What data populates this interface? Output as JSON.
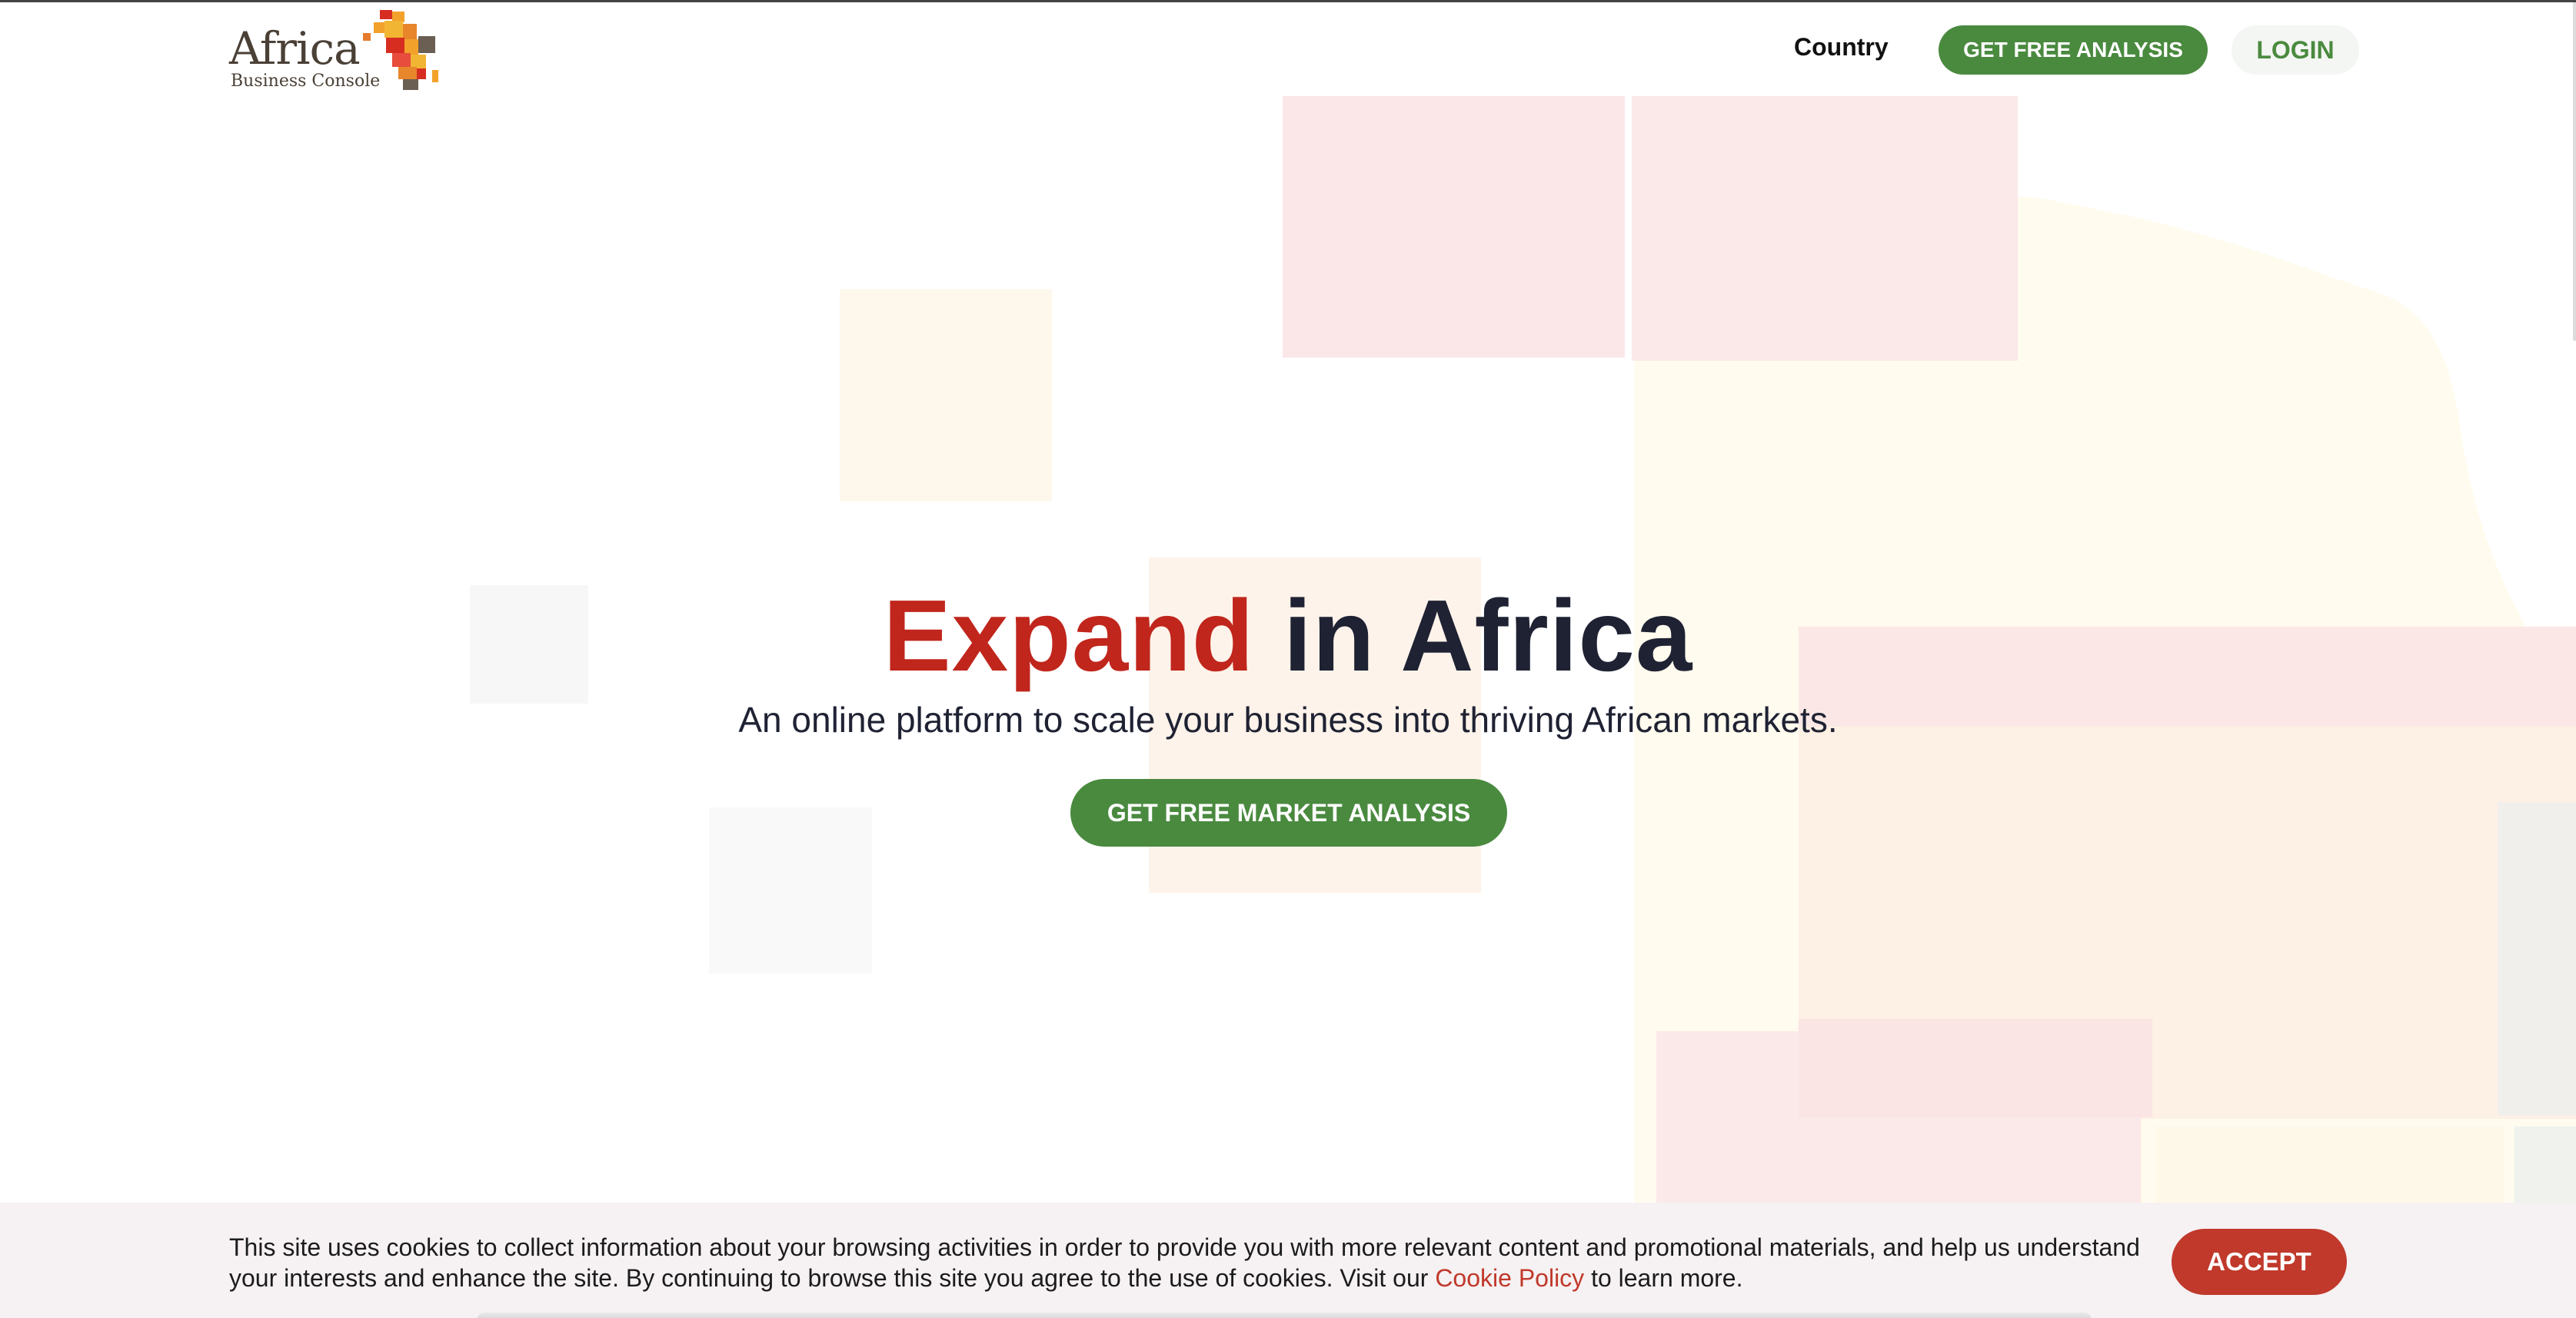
{
  "header": {
    "logo_word": "Africa",
    "logo_sub": "Business Console",
    "nav_country": "Country",
    "cta_label": "GET FREE ANALYSIS",
    "login_label": "LOGIN"
  },
  "hero": {
    "title_accent": "Expand",
    "title_rest": " in Africa",
    "subtitle": "An online platform to scale your business into thriving African markets.",
    "cta_label": "GET FREE MARKET ANALYSIS"
  },
  "cookie": {
    "text_before": "This site uses cookies to collect information about your browsing activities in order to provide you with more relevant content and promotional materials, and help us understand your interests and enhance the site. By continuing to browse this site you agree to the use of cookies. Visit our ",
    "link_label": "Cookie Policy",
    "text_after": " to learn more.",
    "accept_label": "ACCEPT"
  },
  "colors": {
    "brand_green": "#4a8a3f",
    "brand_red": "#c0261c",
    "accept_red": "#c0392b",
    "title_dark": "#1f2233"
  },
  "icons": {
    "logo_mark": "africa-map-icon"
  }
}
